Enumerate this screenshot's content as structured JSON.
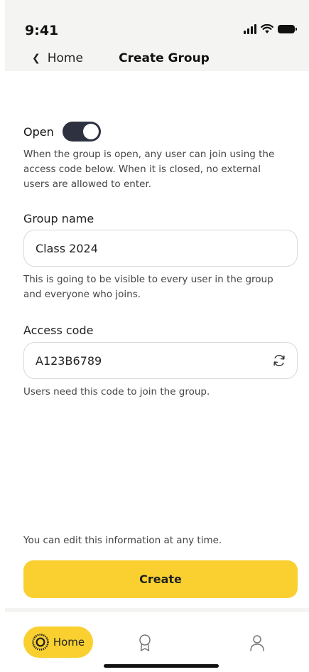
{
  "status_bar": {
    "time": "9:41"
  },
  "nav": {
    "back_label": "Home",
    "title": "Create Group"
  },
  "open_toggle": {
    "label": "Open",
    "state": true,
    "help": "When the group is open, any user can join using the access code below. When it is closed, no external users are allowed to enter."
  },
  "group_name": {
    "label": "Group name",
    "value": "Class 2024",
    "help": "This is going to be visible to every user in the group and everyone who joins."
  },
  "access_code": {
    "label": "Access code",
    "value": "A123B6789",
    "help": "Users need this code to join the group.",
    "icon": "refresh-icon"
  },
  "footer": {
    "note": "You can edit this information at any time.",
    "create_label": "Create"
  },
  "tabbar": {
    "home_label": "Home",
    "items": [
      "home-icon",
      "award-icon",
      "profile-icon"
    ]
  },
  "colors": {
    "accent": "#f9d030",
    "toggle_on": "#2e3140"
  }
}
